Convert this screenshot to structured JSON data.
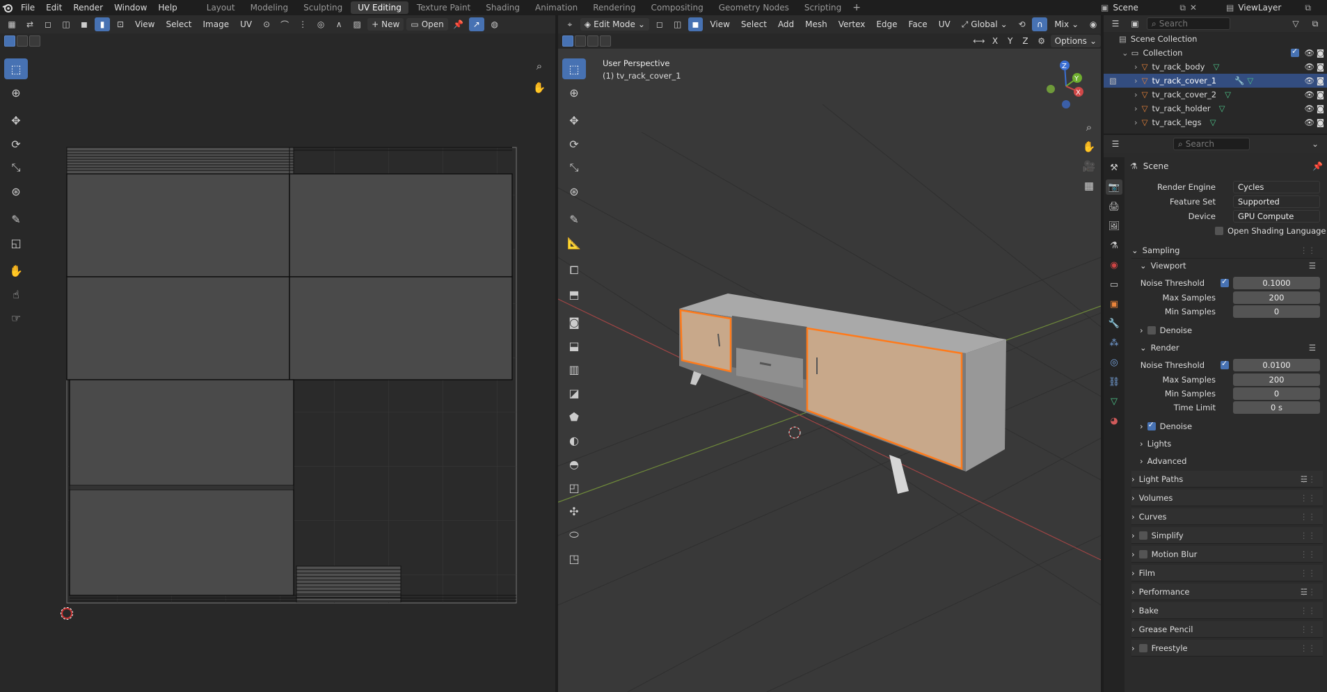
{
  "topbar": {
    "menus": [
      "File",
      "Edit",
      "Render",
      "Window",
      "Help"
    ],
    "workspaces": [
      "Layout",
      "Modeling",
      "Sculpting",
      "UV Editing",
      "Texture Paint",
      "Shading",
      "Animation",
      "Rendering",
      "Compositing",
      "Geometry Nodes",
      "Scripting"
    ],
    "active_workspace": "UV Editing",
    "scene": "Scene",
    "view_layer": "ViewLayer"
  },
  "uv_editor": {
    "menus": [
      "View",
      "Select",
      "Image",
      "UV"
    ],
    "new_label": "New",
    "open_label": "Open"
  },
  "viewport": {
    "mode": "Edit Mode",
    "menus": [
      "View",
      "Select",
      "Add",
      "Mesh",
      "Vertex",
      "Edge",
      "Face",
      "UV"
    ],
    "orientation": "Global",
    "proportional": "Mix",
    "options_label": "Options",
    "axes": [
      "X",
      "Y",
      "Z"
    ],
    "view_name": "User Perspective",
    "object_name": "(1) tv_rack_cover_1"
  },
  "outliner": {
    "search_placeholder": "Search",
    "scene_collection": "Scene Collection",
    "collection": "Collection",
    "objects": [
      "tv_rack_body",
      "tv_rack_cover_1",
      "tv_rack_cover_2",
      "tv_rack_holder",
      "tv_rack_legs"
    ],
    "selected": "tv_rack_cover_1"
  },
  "properties": {
    "search_placeholder": "Search",
    "context": "Scene",
    "render_engine_label": "Render Engine",
    "render_engine": "Cycles",
    "feature_set_label": "Feature Set",
    "feature_set": "Supported",
    "device_label": "Device",
    "device": "GPU Compute",
    "osl_label": "Open Shading Language",
    "sampling": "Sampling",
    "viewport": "Viewport",
    "noise_threshold_label": "Noise Threshold",
    "vp_noise_threshold": "0.1000",
    "max_samples_label": "Max Samples",
    "vp_max_samples": "200",
    "min_samples_label": "Min Samples",
    "vp_min_samples": "0",
    "denoise_label": "Denoise",
    "render": "Render",
    "r_noise_threshold": "0.0100",
    "r_max_samples": "200",
    "r_min_samples": "0",
    "time_limit_label": "Time Limit",
    "r_time_limit": "0 s",
    "lights": "Lights",
    "advanced": "Advanced",
    "sections": [
      "Light Paths",
      "Volumes",
      "Curves",
      "Simplify",
      "Motion Blur",
      "Film",
      "Performance",
      "Bake",
      "Grease Pencil",
      "Freestyle"
    ]
  },
  "colors": {
    "accent": "#4772b3",
    "selected_face": "#c8a88a",
    "selected_edge": "#ff7a1a"
  }
}
